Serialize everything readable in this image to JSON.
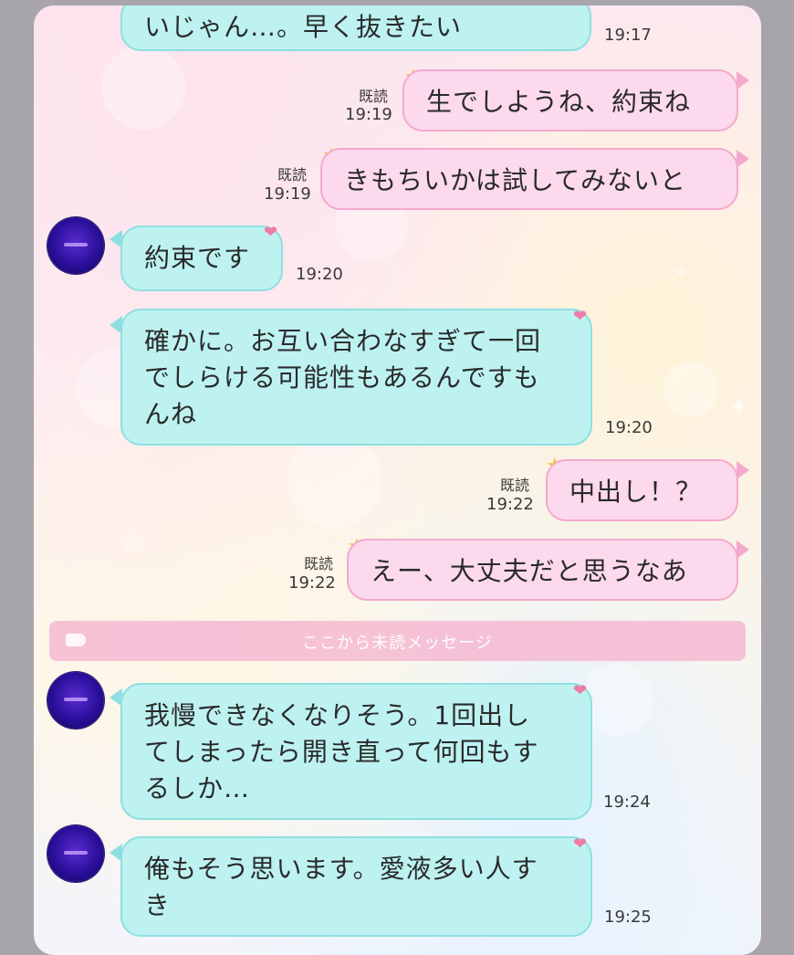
{
  "messages": [
    {
      "text": "いじゃん…。早く抜きたい",
      "time": "19:17"
    },
    {
      "text": "生でしようね、約束ね",
      "read": "既読",
      "time": "19:19"
    },
    {
      "text": "きもちいかは試してみないと",
      "read": "既読",
      "time": "19:19"
    },
    {
      "text": "約束です",
      "time": "19:20"
    },
    {
      "text": "確かに。お互い合わなすぎて一回でしらける可能性もあるんですもんね",
      "lines": [
        "確かに。お互い合わなすぎて一回",
        "でしらける可能性もあるんですも",
        "んね"
      ],
      "time": "19:20"
    },
    {
      "text": "中出し！？",
      "read": "既読",
      "time": "19:22"
    },
    {
      "text": "えー、大丈夫だと思うなあ",
      "read": "既読",
      "time": "19:22"
    },
    {
      "text": "我慢できなくなりそう。1回出してしまったら開き直って何回もするしか…",
      "lines": [
        "我慢できなくなりそう。1回出し",
        "てしまったら開き直って何回もす",
        "るしか…"
      ],
      "time": "19:24"
    },
    {
      "text": "俺もそう思います。愛液多い人すき",
      "lines": [
        "俺もそう思います。愛液多い人す",
        "き"
      ],
      "time": "19:25"
    }
  ],
  "unread_divider": "ここから未読メッセージ",
  "icons": {
    "avatar": "avatar-icon",
    "heart": "heart-icon",
    "star": "star-icon",
    "tag": "tag-icon"
  },
  "colors": {
    "incoming_bubble": "#bdf2f1",
    "outgoing_bubble": "#fcd9ec",
    "unread_bar": "#f6b9d3",
    "background": "#a7a5ab"
  }
}
